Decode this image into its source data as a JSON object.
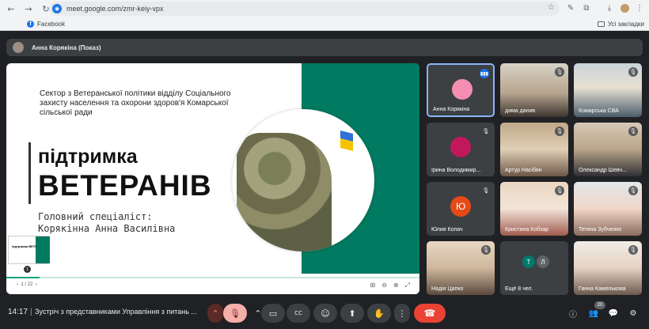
{
  "browser": {
    "url": "meet.google.com/zmr-keiy-vpx",
    "bookmarks": [
      {
        "label": "Facebook"
      }
    ],
    "all_bookmarks_label": "Усі закладки"
  },
  "presenter": {
    "label": "Анна Корякіна (Показ)"
  },
  "slide": {
    "header": "Сектор з Ветеранської політики відділу Соціального захисту населення та охорони здоров'я Комарської сільської ради",
    "title_line1": "підтримка",
    "title_line2": "ВЕТЕРАНІВ",
    "subtitle_line1": "Головний спеціаліст:",
    "subtitle_line2": "Корякінна Анна Василівна",
    "thumb_title": "підтримка ВЕТЕРАНІВ",
    "page_indicator": "1 / 22",
    "slide_number": "1",
    "progress": 0.08
  },
  "participants": [
    {
      "name": "Анна Корякіна",
      "speaking": true,
      "type": "avatar",
      "color": "#f48fb1"
    },
    {
      "name": "дима данив",
      "speaking": false,
      "type": "photo"
    },
    {
      "name": "Комарська СВА",
      "speaking": false,
      "type": "photo"
    },
    {
      "name": "Ірина Володимир...",
      "speaking": false,
      "type": "avatar",
      "color": "#c2185b"
    },
    {
      "name": "Артур Насібян",
      "speaking": false,
      "type": "photo"
    },
    {
      "name": "Олександр Шевч...",
      "speaking": false,
      "type": "photo"
    },
    {
      "name": "Юлия Копач",
      "speaking": false,
      "type": "letter",
      "letter": "Ю",
      "color": "#e64a19"
    },
    {
      "name": "Кристина Кобзар",
      "speaking": false,
      "type": "photo"
    },
    {
      "name": "Тетяна Зубченко",
      "speaking": false,
      "type": "photo"
    },
    {
      "name": "Надія Цапко",
      "speaking": false,
      "type": "photo"
    },
    {
      "name": "Ещё 8 чел.",
      "speaking": false,
      "type": "more",
      "letters": [
        "Т",
        "Л"
      ]
    },
    {
      "name": "Ганна Камелькова",
      "speaking": false,
      "type": "photo"
    }
  ],
  "bottom_bar": {
    "time": "14:17",
    "separator": "|",
    "meeting_title": "Зустріч з представниками Управління з питань ...",
    "participant_count": "20"
  },
  "icons": {
    "back": "←",
    "forward": "→",
    "reload": "↻",
    "star": "☆",
    "mic_off": "🎤",
    "camera": "▭",
    "captions": "CC",
    "emoji": "☺",
    "present": "⬆",
    "hand": "✋",
    "more": "⋮",
    "end_call": "☎",
    "info": "ⓘ",
    "people": "👥",
    "chat": "💬",
    "activities": "⚙"
  }
}
